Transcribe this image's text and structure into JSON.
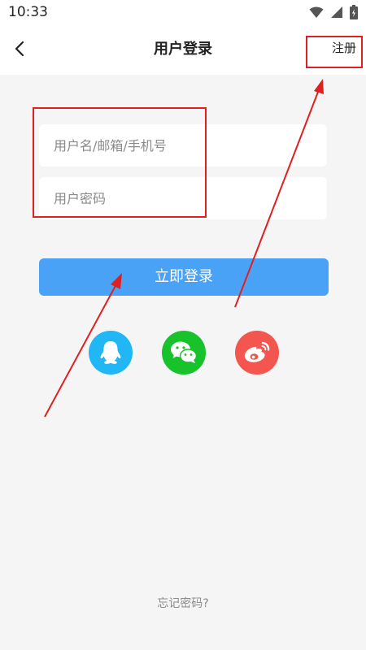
{
  "status_bar": {
    "time": "10:33"
  },
  "header": {
    "title": "用户登录",
    "register_label": "注册"
  },
  "form": {
    "username_placeholder": "用户名/邮箱/手机号",
    "password_placeholder": "用户密码",
    "login_label": "立即登录"
  },
  "social": [
    {
      "icon": "qq-icon",
      "color": "#21b6f4"
    },
    {
      "icon": "wechat-icon",
      "color": "#17c22b"
    },
    {
      "icon": "weibo-icon",
      "color": "#f2564f"
    }
  ],
  "footer": {
    "forgot_label": "忘记密码?"
  },
  "colors": {
    "primary": "#4aa2f6",
    "annotation": "#e02020"
  }
}
